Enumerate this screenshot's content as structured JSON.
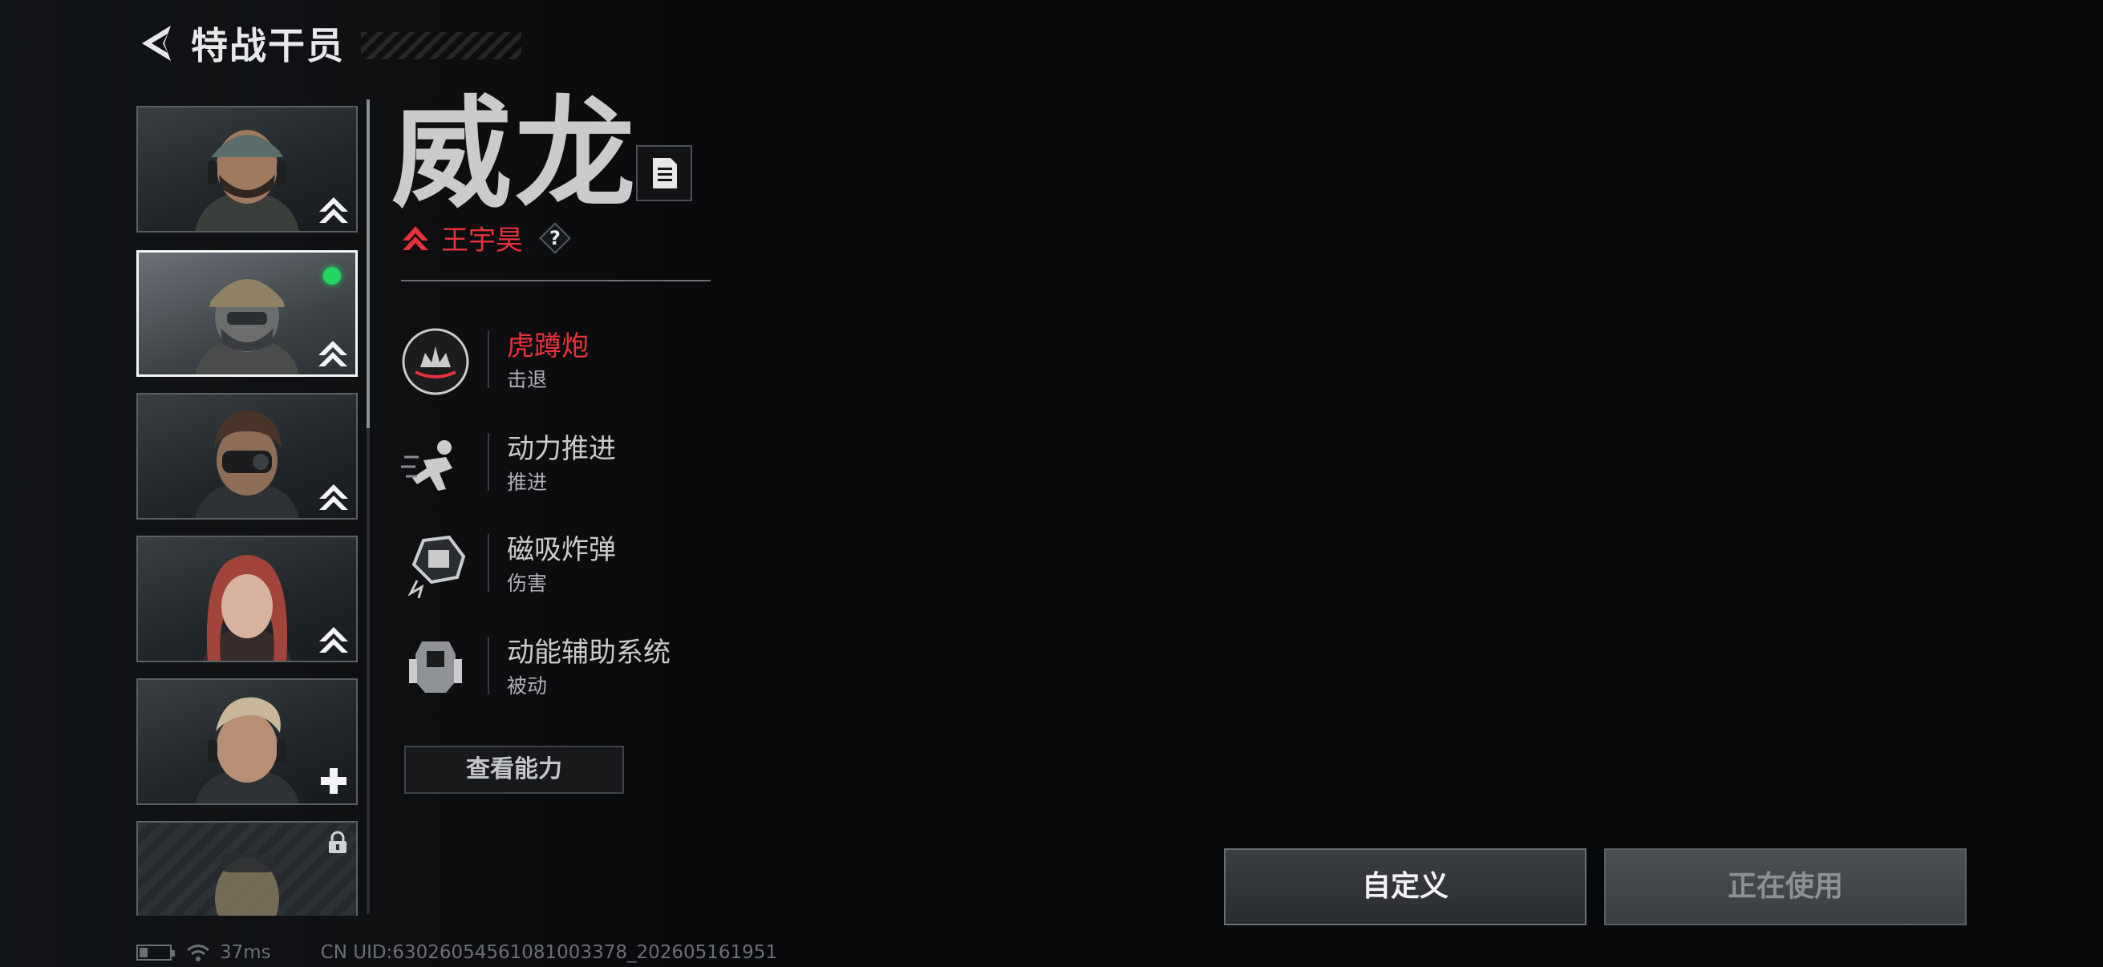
{
  "header": {
    "title": "特战干员"
  },
  "operator": {
    "name": "威龙",
    "role_name": "王宇昊",
    "help_label": "?"
  },
  "abilities": [
    {
      "name": "虎蹲炮",
      "type": "击退",
      "icon": "mortar-icon",
      "active": true
    },
    {
      "name": "动力推进",
      "type": "推进",
      "icon": "dash-icon",
      "active": false
    },
    {
      "name": "磁吸炸弹",
      "type": "伤害",
      "icon": "magnet-bomb-icon",
      "active": false
    },
    {
      "name": "动能辅助系统",
      "type": "被动",
      "icon": "exo-suit-icon",
      "active": false
    }
  ],
  "view_abilities_label": "查看能力",
  "buttons": {
    "customize": "自定义",
    "in_use": "正在使用"
  },
  "status": {
    "ping": "37ms",
    "uid": "CN UID:630260545610810033​78_202605161951"
  },
  "colors": {
    "accent_red": "#e8323a",
    "online_green": "#22d55e"
  }
}
